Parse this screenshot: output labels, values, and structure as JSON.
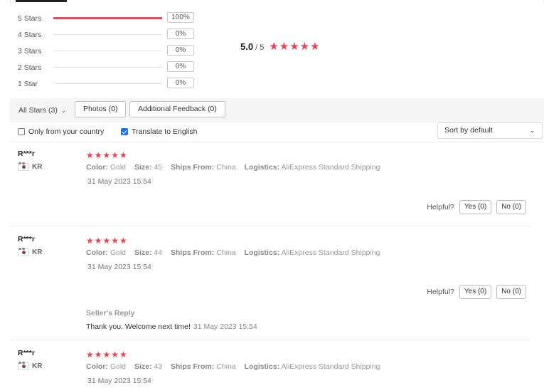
{
  "rating_summary": {
    "rows": [
      {
        "label": "5 Stars",
        "pct": "100%",
        "fill": 1.0
      },
      {
        "label": "4 Stars",
        "pct": "0%",
        "fill": 0
      },
      {
        "label": "3 Stars",
        "pct": "0%",
        "fill": 0
      },
      {
        "label": "2 Stars",
        "pct": "0%",
        "fill": 0
      },
      {
        "label": "1 Star",
        "pct": "0%",
        "fill": 0
      }
    ],
    "score": "5.0",
    "out_of": "/ 5",
    "stars_display": "★★★★★"
  },
  "filters": {
    "all_stars": "All Stars (3)",
    "photos": "Photos (0)",
    "additional": "Additional Feedback (0)",
    "only_country": "Only from your country",
    "translate": "Translate to English",
    "translate_checked": true,
    "sort": "Sort by default"
  },
  "reviews": [
    {
      "name": "R***r",
      "country": "KR",
      "stars": "★★★★★",
      "color_label": "Color:",
      "color": "Gold",
      "size_label": "Size:",
      "size": "45",
      "ships_label": "Ships From:",
      "ships": "China",
      "logistics_label": "Logistics:",
      "logistics": "AliExpress Standard Shipping",
      "date": "31 May 2023 15:54",
      "helpful_label": "Helpful?",
      "yes": "Yes (0)",
      "no": "No (0)"
    },
    {
      "name": "R***r",
      "country": "KR",
      "stars": "★★★★★",
      "color_label": "Color:",
      "color": "Gold",
      "size_label": "Size:",
      "size": "44",
      "ships_label": "Ships From:",
      "ships": "China",
      "logistics_label": "Logistics:",
      "logistics": "AliExpress Standard Shipping",
      "date": "31 May 2023 15:54",
      "helpful_label": "Helpful?",
      "yes": "Yes (0)",
      "no": "No (0)",
      "seller_reply_label": "Seller's Reply",
      "seller_reply": "Thank you. Welcome next time!",
      "seller_reply_date": "31 May 2023 15:54"
    },
    {
      "name": "R***r",
      "country": "KR",
      "stars": "★★★★★",
      "color_label": "Color:",
      "color": "Gold",
      "size_label": "Size:",
      "size": "43",
      "ships_label": "Ships From:",
      "ships": "China",
      "logistics_label": "Logistics:",
      "logistics": "AliExpress Standard Shipping",
      "date": "31 May 2023 15:54"
    }
  ],
  "colors": {
    "accent_red": "#e8404f",
    "checkbox_blue": "#1a73e8"
  }
}
